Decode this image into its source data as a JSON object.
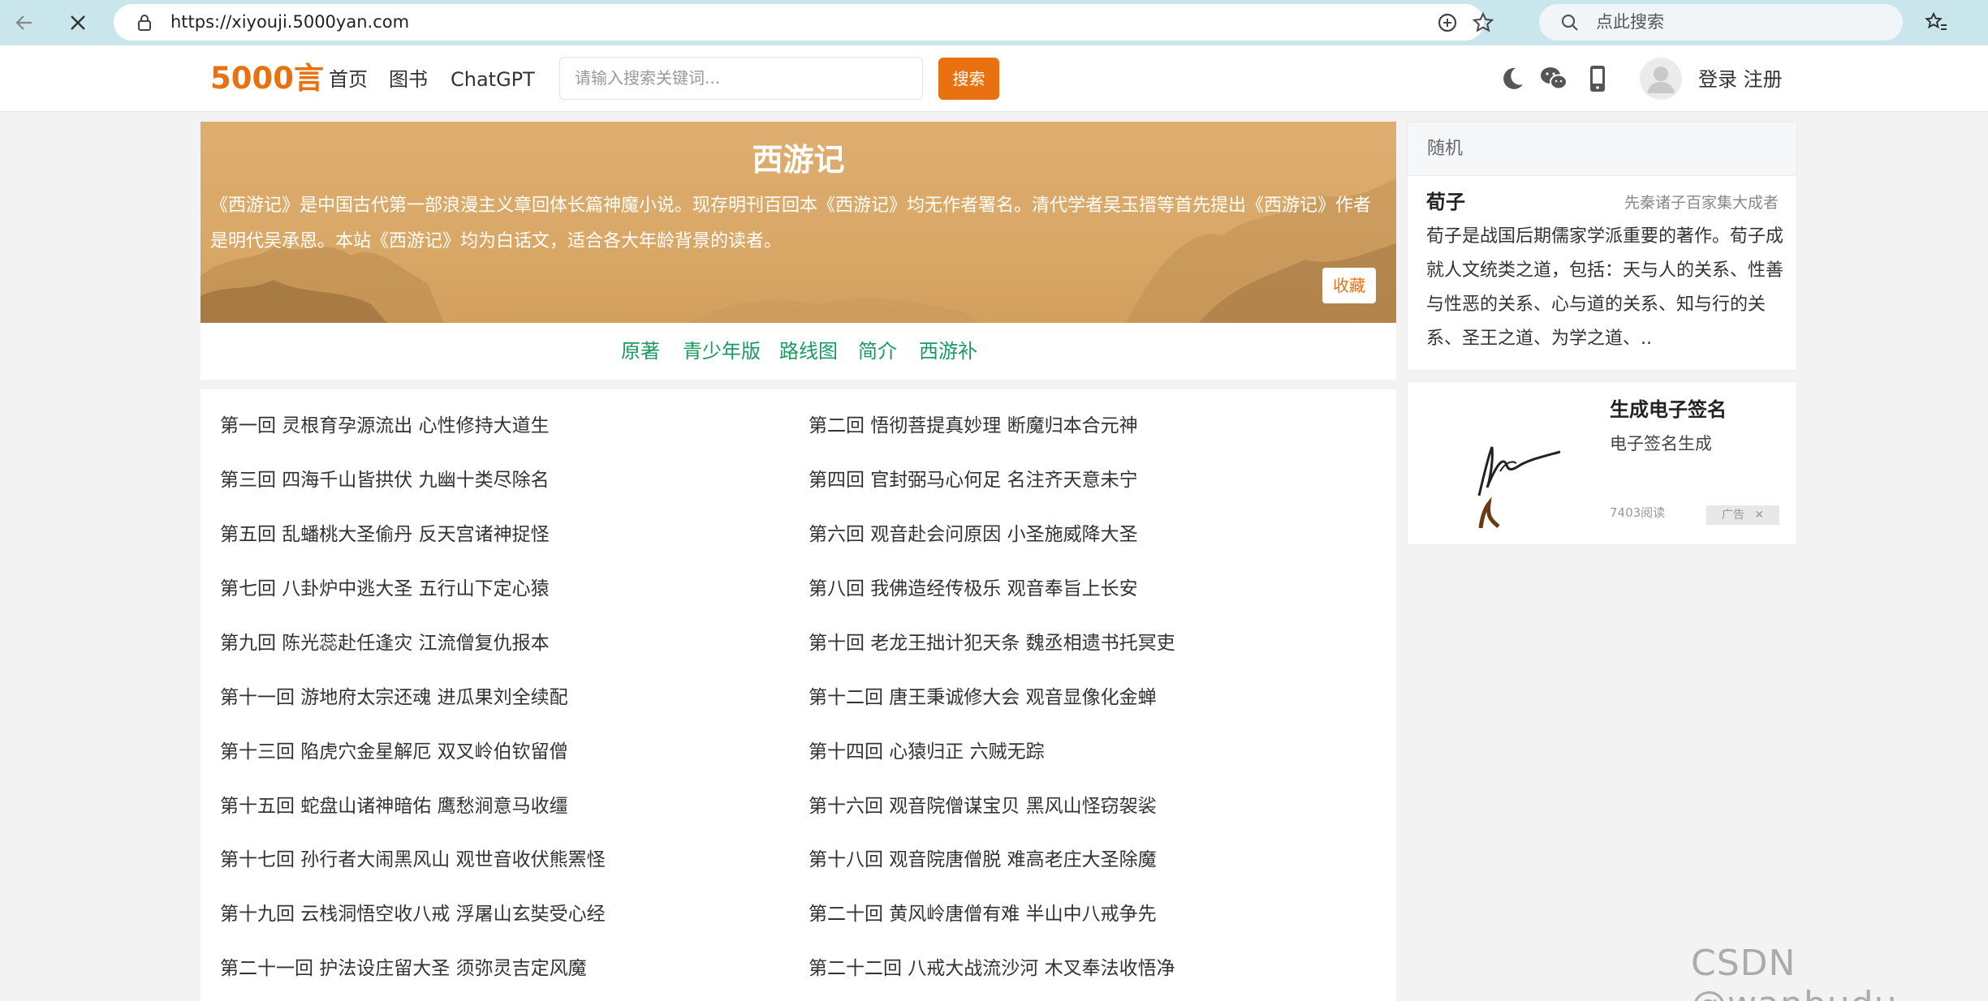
{
  "browser": {
    "url": "https://xiyouji.5000yan.com",
    "search_placeholder": "点此搜索"
  },
  "header": {
    "logo": "5000言",
    "nav": [
      "首页",
      "图书",
      "ChatGPT"
    ],
    "search_placeholder": "请输入搜索关键词...",
    "search_button": "搜索",
    "login": "登录",
    "register": "注册"
  },
  "hero": {
    "title": "西游记",
    "description": "《西游记》是中国古代第一部浪漫主义章回体长篇神魔小说。现存明刊百回本《西游记》均无作者署名。清代学者吴玉搢等首先提出《西游记》作者是明代吴承恩。本站《西游记》均为白话文，适合各大年龄背景的读者。",
    "favorite": "收藏"
  },
  "subnav": [
    "原著",
    "青少年版",
    "路线图",
    "简介",
    "西游补"
  ],
  "chapters": [
    "第一回 灵根育孕源流出 心性修持大道生",
    "第二回 悟彻菩提真妙理 断魔归本合元神",
    "第三回 四海千山皆拱伏 九幽十类尽除名",
    "第四回 官封弼马心何足 名注齐天意未宁",
    "第五回 乱蟠桃大圣偷丹 反天宫诸神捉怪",
    "第六回 观音赴会问原因 小圣施威降大圣",
    "第七回 八卦炉中逃大圣 五行山下定心猿",
    "第八回 我佛造经传极乐 观音奉旨上长安",
    "第九回 陈光蕊赴任逢灾 江流僧复仇报本",
    "第十回 老龙王拙计犯天条 魏丞相遗书托冥吏",
    "第十一回 游地府太宗还魂 进瓜果刘全续配",
    "第十二回 唐王秉诚修大会 观音显像化金蝉",
    "第十三回 陷虎穴金星解厄 双叉岭伯钦留僧",
    "第十四回 心猿归正 六贼无踪",
    "第十五回 蛇盘山诸神暗佑 鹰愁涧意马收缰",
    "第十六回 观音院僧谋宝贝 黑风山怪窃袈裟",
    "第十七回 孙行者大闹黑风山 观世音收伏熊罴怪",
    "第十八回 观音院唐僧脱 难高老庄大圣除魔",
    "第十九回 云栈洞悟空收八戒 浮屠山玄奘受心经",
    "第二十回 黄风岭唐僧有难 半山中八戒争先",
    "第二十一回 护法设庄留大圣 须弥灵吉定风魔",
    "第二十二回 八戒大战流沙河 木叉奉法收悟净"
  ],
  "sidebar": {
    "random_title": "随机",
    "book_name": "荀子",
    "book_category": "先秦诸子百家集大成者",
    "book_description": "荀子是战国后期儒家学派重要的著作。荀子成就人文统类之道，包括：天与人的关系、性善与性恶的关系、心与道的关系、知与行的关系、圣王之道、为学之道、..",
    "ad_title": "生成电子签名",
    "ad_subtitle": "电子签名生成",
    "ad_reads": "7403阅读",
    "ad_badge": "广告"
  },
  "watermark": "CSDN @wanbudu",
  "colors": {
    "brand_orange": "#e9710f",
    "link_green": "#1a9a5f",
    "hero_bg": "#d9a867",
    "browser_chrome": "#c8e6ec"
  }
}
